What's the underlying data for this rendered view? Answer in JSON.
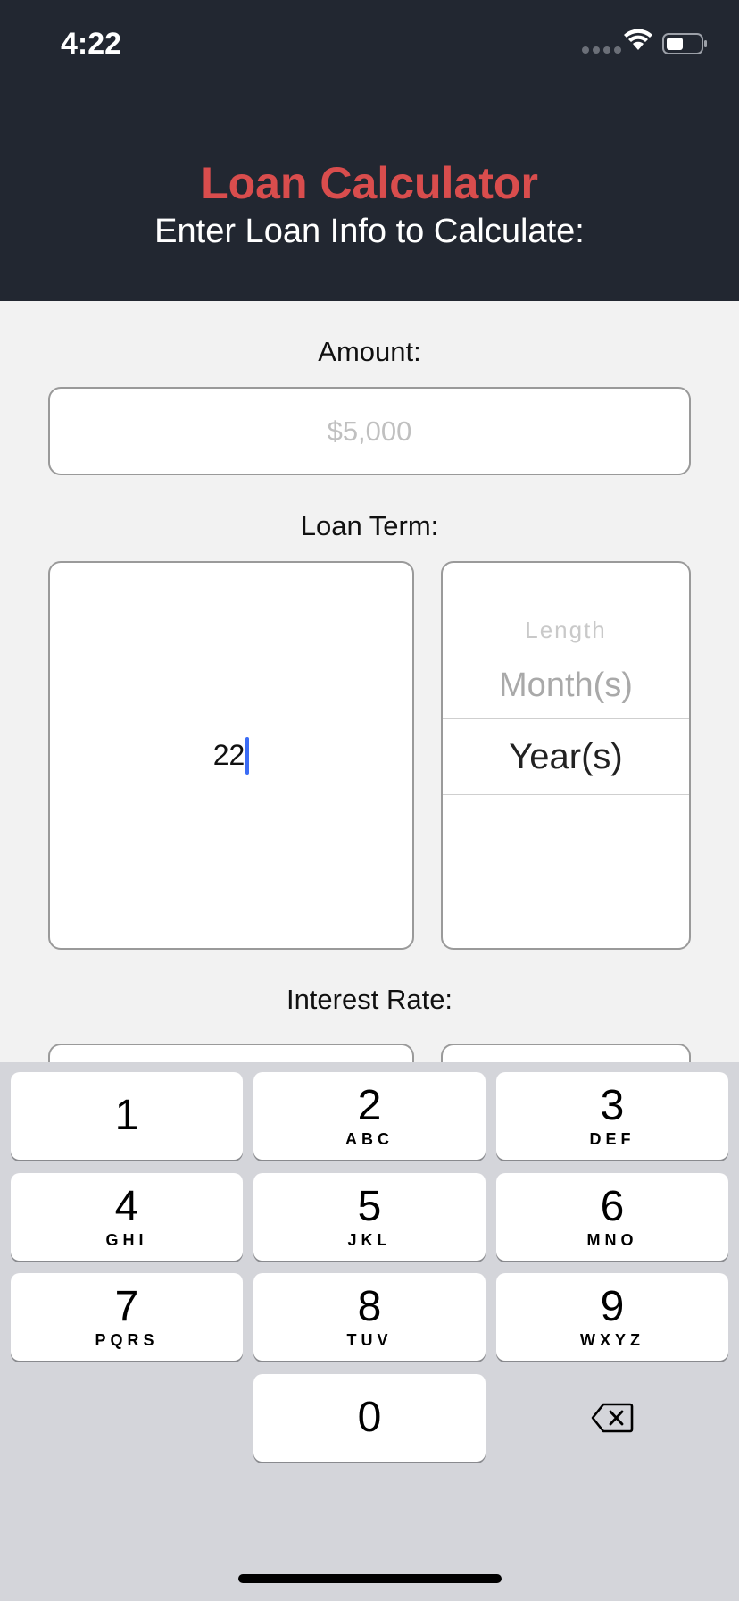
{
  "status_bar": {
    "time": "4:22",
    "icons": [
      "signal-icon",
      "wifi-icon",
      "battery-icon"
    ]
  },
  "header": {
    "title": "Loan Calculator",
    "subtitle": "Enter Loan Info to Calculate:",
    "title_color": "#d94d4d",
    "background": "#222731"
  },
  "amount": {
    "label": "Amount:",
    "placeholder": "$5,000",
    "value": ""
  },
  "loan_term": {
    "label": "Loan Term:",
    "value": "22",
    "picker": {
      "header": "Length",
      "options": [
        "Month(s)",
        "Year(s)"
      ],
      "selected": "Year(s)"
    }
  },
  "interest_rate": {
    "label": "Interest Rate:"
  },
  "keyboard": {
    "keys": [
      {
        "num": "1",
        "letters": ""
      },
      {
        "num": "2",
        "letters": "ABC"
      },
      {
        "num": "3",
        "letters": "DEF"
      },
      {
        "num": "4",
        "letters": "GHI"
      },
      {
        "num": "5",
        "letters": "JKL"
      },
      {
        "num": "6",
        "letters": "MNO"
      },
      {
        "num": "7",
        "letters": "PQRS"
      },
      {
        "num": "8",
        "letters": "TUV"
      },
      {
        "num": "9",
        "letters": "WXYZ"
      },
      {
        "num": "0",
        "letters": ""
      }
    ],
    "delete_icon": "backspace-icon"
  }
}
